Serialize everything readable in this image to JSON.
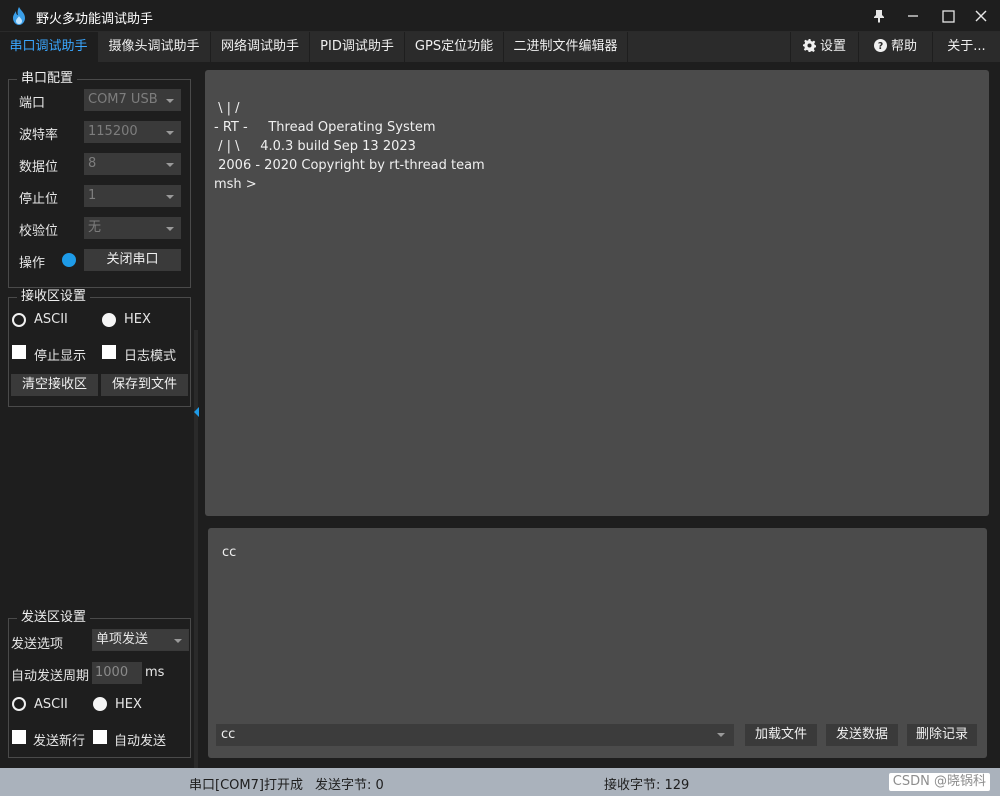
{
  "window": {
    "title": "野火多功能调试助手"
  },
  "tabs": [
    {
      "label": "串口调试助手",
      "active": true
    },
    {
      "label": "摄像头调试助手"
    },
    {
      "label": "网络调试助手"
    },
    {
      "label": "PID调试助手"
    },
    {
      "label": "GPS定位功能"
    },
    {
      "label": "二进制文件编辑器"
    }
  ],
  "right_buttons": {
    "settings": "设置",
    "help": "帮助",
    "about": "关于..."
  },
  "serial_config": {
    "title": "串口配置",
    "port_label": "端口",
    "port_value": "COM7 USB",
    "baud_label": "波特率",
    "baud_value": "115200",
    "databits_label": "数据位",
    "databits_value": "8",
    "stopbits_label": "停止位",
    "stopbits_value": "1",
    "parity_label": "校验位",
    "parity_value": "无",
    "operation_label": "操作",
    "close_button": "关闭串口"
  },
  "recv_settings": {
    "title": "接收区设置",
    "ascii_label": "ASCII",
    "hex_label": "HEX",
    "stop_display_label": "停止显示",
    "log_mode_label": "日志模式",
    "clear_button": "清空接收区",
    "save_button": "保存到文件"
  },
  "send_settings": {
    "title": "发送区设置",
    "option_label": "发送选项",
    "option_value": "单项发送",
    "period_label": "自动发送周期",
    "period_value": "1000",
    "period_unit": "ms",
    "ascii_label": "ASCII",
    "hex_label": "HEX",
    "newline_label": "发送新行",
    "auto_send_label": "自动发送"
  },
  "receive_area": {
    "lines": [
      " \\ | /",
      "- RT -     Thread Operating System",
      " / | \\     4.0.3 build Sep 13 2023",
      " 2006 - 2020 Copyright by rt-thread team",
      "msh >"
    ]
  },
  "send_area": {
    "text": "cc",
    "history_value": "cc",
    "load_file_button": "加载文件",
    "send_button": "发送数据",
    "delete_history_button": "删除记录"
  },
  "status_bar": {
    "port_status": "串口[COM7]打开成",
    "sent_bytes": "发送字节: 0",
    "received_bytes": "接收字节: 129",
    "watermark": "CSDN @晓锅科"
  },
  "colors": {
    "accent": "#3aa7ff",
    "status_dot": "#1e9be8",
    "panel": "#4b4b4b",
    "background": "#1e1e1e"
  }
}
